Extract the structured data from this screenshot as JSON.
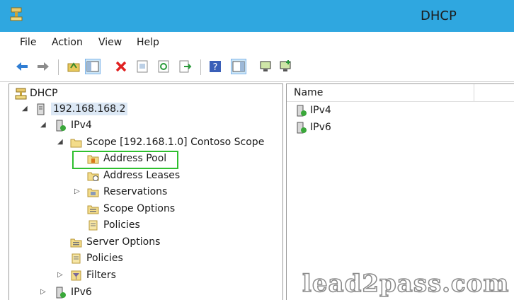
{
  "window": {
    "title": "DHCP"
  },
  "menu": [
    {
      "label": "File"
    },
    {
      "label": "Action"
    },
    {
      "label": "View"
    },
    {
      "label": "Help"
    }
  ],
  "toolbar": {
    "buttons": [
      "back-icon",
      "forward-icon",
      "up-folder-icon",
      "show-hide-tree-icon",
      "delete-icon",
      "properties-icon",
      "refresh-icon",
      "export-list-icon",
      "help-icon",
      "show-hide-action-pane-icon",
      "computer-icon",
      "computer-add-icon"
    ]
  },
  "tree": {
    "root": "DHCP",
    "server": "192.168.168.2",
    "ipv4": "IPv4",
    "scope": "Scope [192.168.1.0] Contoso Scope",
    "address_pool": "Address Pool",
    "address_leases": "Address Leases",
    "reservations": "Reservations",
    "scope_options": "Scope Options",
    "scope_policies": "Policies",
    "server_options": "Server Options",
    "policies": "Policies",
    "filters": "Filters",
    "ipv6": "IPv6"
  },
  "list": {
    "column_name": "Name",
    "items": [
      "IPv4",
      "IPv6"
    ]
  },
  "watermark": "lead2pass.com"
}
